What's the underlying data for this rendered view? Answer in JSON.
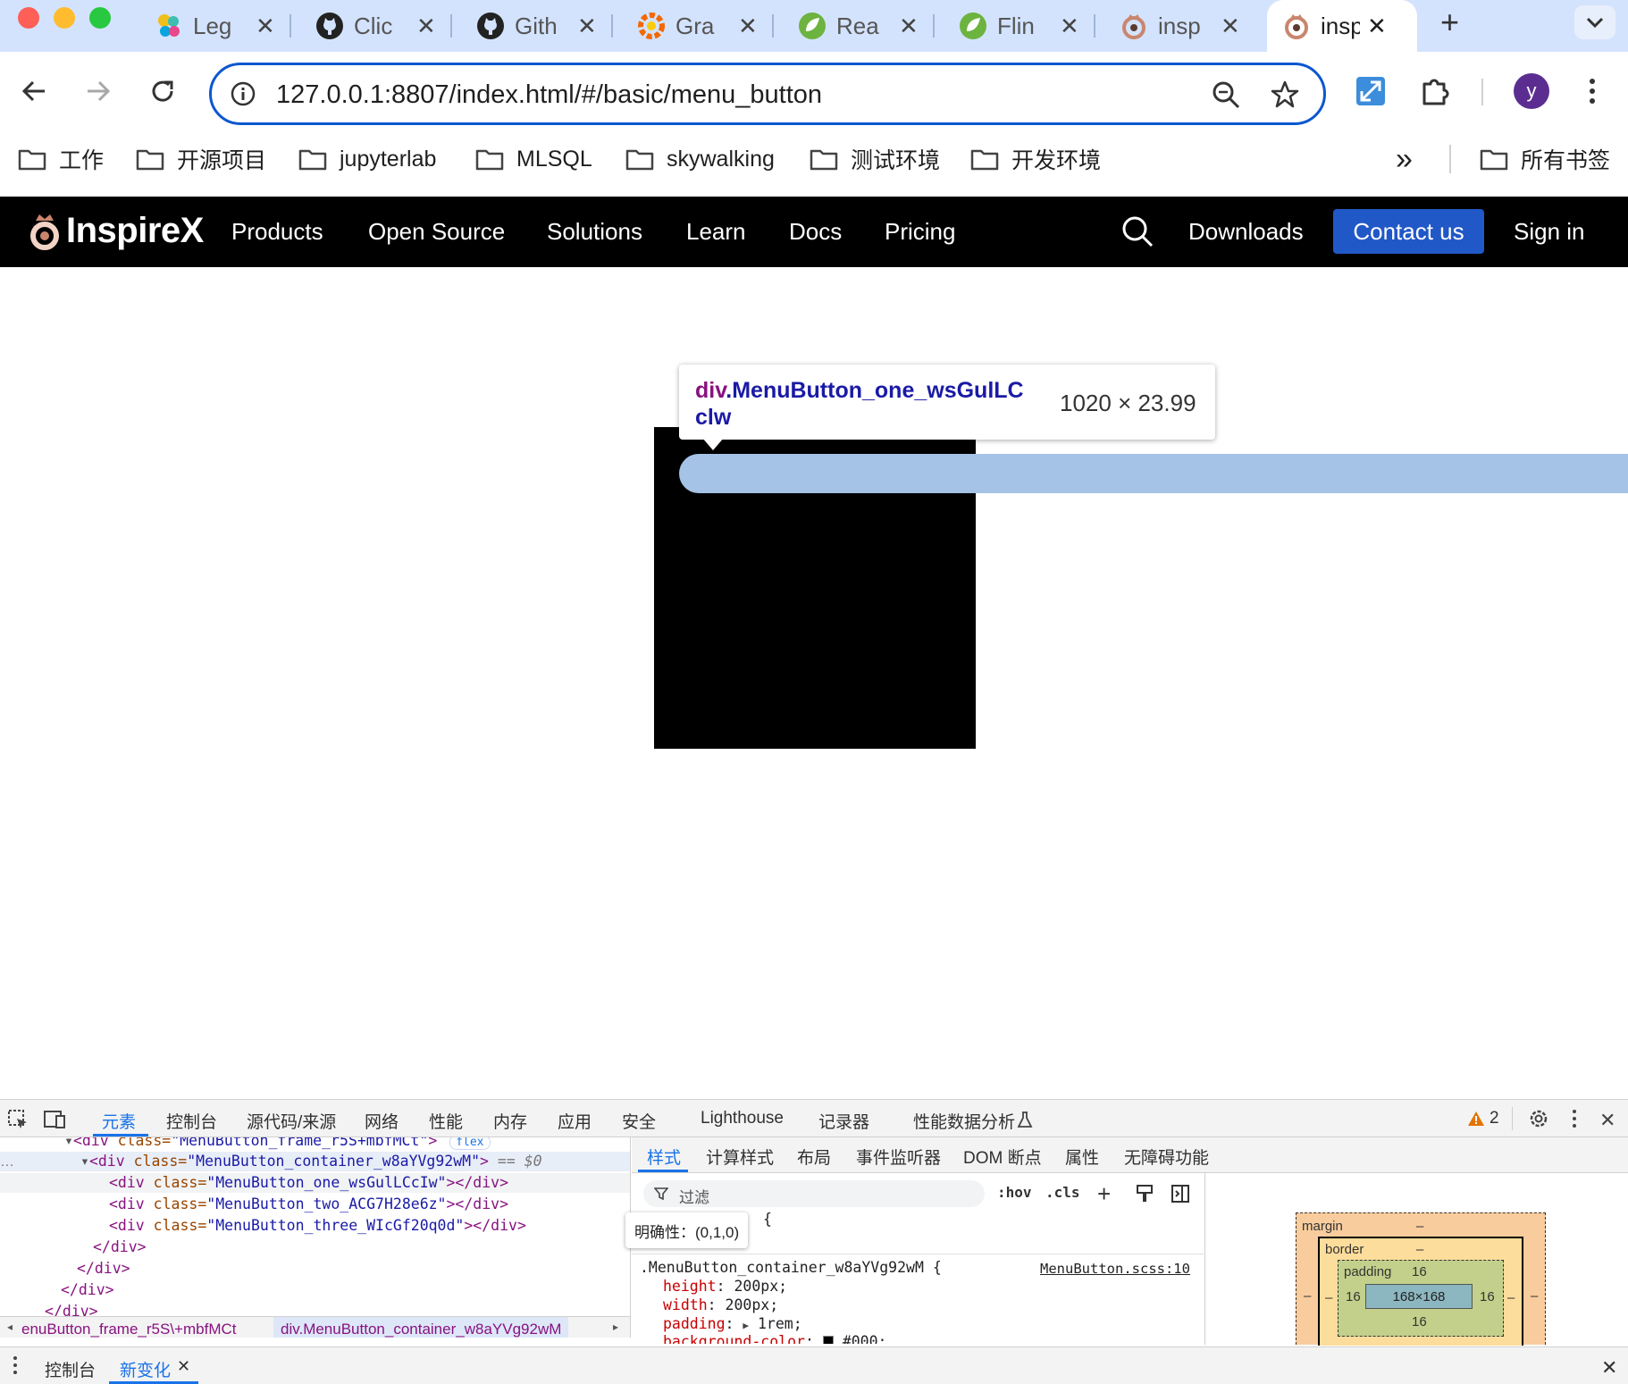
{
  "browser": {
    "tabs": [
      {
        "title": "Leg",
        "icon": "elastic-icon"
      },
      {
        "title": "Clic",
        "icon": "github-icon"
      },
      {
        "title": "Gith",
        "icon": "github-icon"
      },
      {
        "title": "Gra",
        "icon": "grafana-icon"
      },
      {
        "title": "Rea",
        "icon": "spring-icon"
      },
      {
        "title": "Flin",
        "icon": "spring-icon"
      },
      {
        "title": "insp",
        "icon": "inspirex-icon"
      },
      {
        "title": "insp",
        "icon": "inspirex-icon",
        "active": true
      }
    ],
    "new_tab_label": "+",
    "url": "127.0.0.1:8807/index.html/#/basic/menu_button",
    "profile_initial": "y",
    "bookmarks": [
      "工作",
      "开源项目",
      "jupyterlab",
      "MLSQL",
      "skywalking",
      "测试环境",
      "开发环境"
    ],
    "bookmarks_overflow": "»",
    "all_bookmarks": "所有书签"
  },
  "site": {
    "logo": "InspireX",
    "nav": [
      "Products",
      "Open Source",
      "Solutions",
      "Learn",
      "Docs",
      "Pricing"
    ],
    "downloads": "Downloads",
    "contact": "Contact us",
    "signin": "Sign in",
    "brand_color": "#2158c7"
  },
  "inspector_tooltip": {
    "tag": "div",
    "class_name": ".MenuButton_one_wsGulLC",
    "class_name_cont": "clw",
    "size": "1020 × 23.99"
  },
  "devtools": {
    "tabs": [
      "元素",
      "控制台",
      "源代码/来源",
      "网络",
      "性能",
      "内存",
      "应用",
      "安全",
      "Lighthouse",
      "记录器",
      "性能数据分析"
    ],
    "warning_count": "2",
    "dom": {
      "line0_tag": "<div ",
      "line0_attr": "class=",
      "line0_val": "\"MenuButton_frame_r5S+mbfMCt\"",
      "line0_badge": "flex",
      "line1_tag": "<div ",
      "line1_attr": "class=",
      "line1_val": "\"MenuButton_container_w8aYVg92wM\"",
      "line1_end": ">",
      "line1_eq": " == $0",
      "child1": "\"MenuButton_one_wsGulLCcIw\"",
      "child2": "\"MenuButton_two_ACG7H28e6z\"",
      "child3": "\"MenuButton_three_WIcGf20q0d\"",
      "close_div": "</div>",
      "open_div": "<div ",
      "class_attr": "class=",
      "child_end": "></div>"
    },
    "breadcrumbs": [
      "enuButton_frame_r5S\\+mbfMCt",
      "div.MenuButton_container_w8aYVg92wM"
    ],
    "styles_tabs": [
      "样式",
      "计算样式",
      "布局",
      "事件监听器",
      "DOM 断点",
      "属性",
      "无障碍功能"
    ],
    "filter_placeholder": "过滤",
    "hov": ":hov",
    "cls": ".cls",
    "specificity_tooltip": "明确性：(0,1,0)",
    "rule_selector": ".MenuButton_container_w8aYVg92wM {",
    "rule_source": "MenuButton.scss:10",
    "brace_open": "{",
    "props": [
      {
        "name": "height",
        "value": "200px;"
      },
      {
        "name": "width",
        "value": "200px;"
      },
      {
        "name": "padding",
        "value": "1rem;"
      },
      {
        "name": "background-color",
        "value": "#000;"
      }
    ],
    "box_model": {
      "margin_label": "margin",
      "margin_val": "–",
      "border_label": "border",
      "border_val": "–",
      "padding_label": "padding",
      "padding_top": "16",
      "padding_left": "16",
      "padding_right": "16",
      "padding_bottom": "16",
      "content": "168×168",
      "dash": "–"
    },
    "drawer_tabs": [
      "控制台",
      "新变化"
    ]
  }
}
